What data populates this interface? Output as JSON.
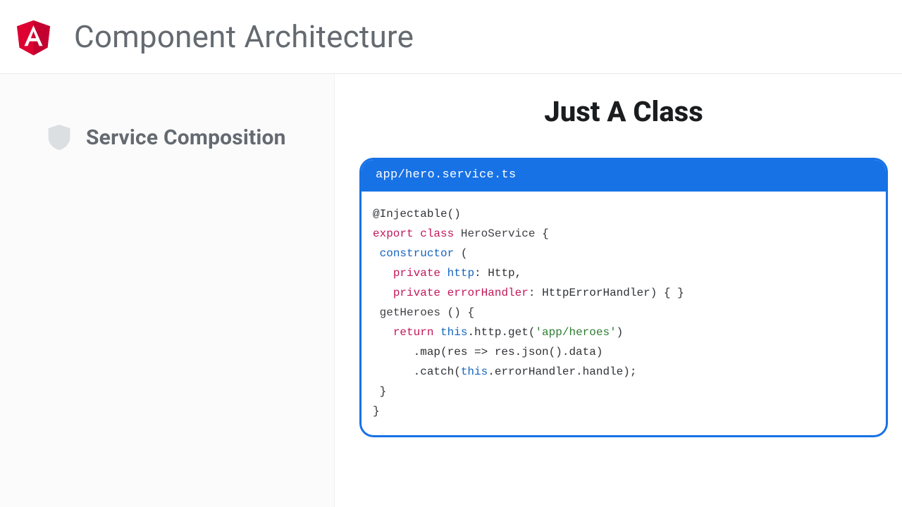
{
  "header": {
    "title": "Component Architecture"
  },
  "sidebar": {
    "item_label": "Service Composition"
  },
  "content": {
    "heading": "Just A Class",
    "file_path": "app/hero.service.ts"
  },
  "code": {
    "l1_a": "@Injectable()",
    "l2_export": "export",
    "l2_class": "class",
    "l2_name": "HeroService",
    "l2_brace": " {",
    "l3_ctor": "constructor",
    "l3_paren": " (",
    "l4_private": "private",
    "l4_http": "http",
    "l4_colon": ": Http,",
    "l5_private": "private",
    "l5_err": "errorHandler",
    "l5_rest": ": HttpErrorHandler) { }",
    "l6_fn": "getHeroes",
    "l6_rest": " () {",
    "l7_return": "return",
    "l7_this": "this",
    "l7_httpget": ".http.get(",
    "l7_str": "'app/heroes'",
    "l7_close": ")",
    "l8": ".map(res => res.json().data)",
    "l9_a": ".catch(",
    "l9_this": "this",
    "l9_b": ".errorHandler.handle);",
    "l10": "}",
    "l11": "}"
  },
  "colors": {
    "accent": "#1772e6",
    "angular_red": "#dd0031",
    "angular_dark": "#c3002f"
  }
}
